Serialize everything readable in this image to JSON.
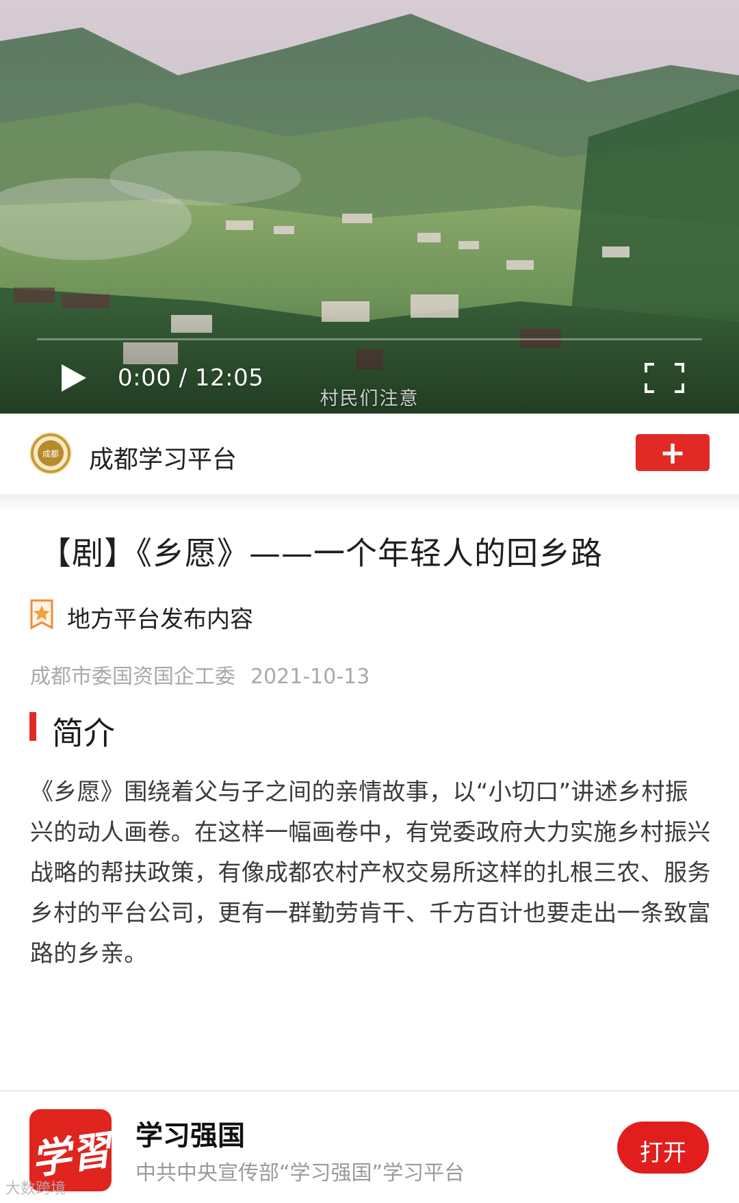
{
  "video": {
    "time_display": "0:00 / 12:05",
    "subtitle": "村民们注意",
    "progress_fraction": 0.0
  },
  "channel": {
    "name": "成都学习平台",
    "logo_text": "成都",
    "follow_label": "+"
  },
  "article": {
    "title": "【剧】《乡愿》——一个年轻人的回乡路",
    "source_label": "地方平台发布内容",
    "publisher": "成都市委国资国企工委",
    "date": "2021-10-13",
    "section_title": "简介",
    "description": "《乡愿》围绕着父与子之间的亲情故事，以“小切口”讲述乡村振兴的动人画卷。在这样一幅画卷中，有党委政府大力实施乡村振兴战略的帮扶政策，有像成都农村产权交易所这样的扎根三农、服务乡村的平台公司，更有一群勤劳肯干、千方百计也要走出一条致富路的乡亲。"
  },
  "banner": {
    "app_icon_text": "学習",
    "app_name": "学习强国",
    "app_slogan": "中共中央宣传部“学习强国”学习平台",
    "open_label": "打开"
  },
  "watermark": "大数跨境",
  "colors": {
    "accent_red": "#e12a25",
    "meta_gray": "#a9a9a9",
    "source_icon_orange": "#f08a3c"
  }
}
